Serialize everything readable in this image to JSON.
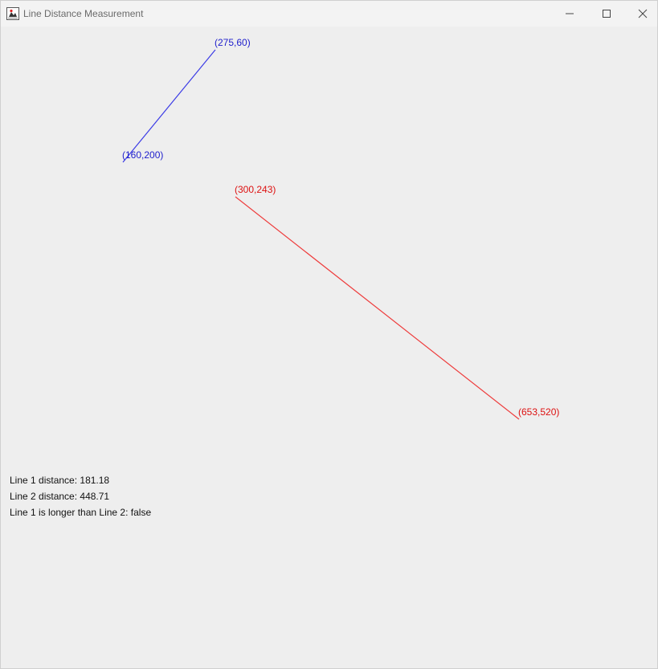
{
  "window": {
    "title": "Line Distance Measurement",
    "app_icon": "java-app-icon",
    "controls": {
      "minimize_icon": "minimize-icon",
      "maximize_icon": "maximize-icon",
      "close_icon": "close-icon"
    }
  },
  "lines": [
    {
      "name": "Line 1",
      "color": "#3b3be6",
      "label_color": "#1e1ecc",
      "start": {
        "label": "(160,200)"
      },
      "end": {
        "label": "(275,60)"
      }
    },
    {
      "name": "Line 2",
      "color": "#ee3b3b",
      "label_color": "#dd1111",
      "start": {
        "label": "(300,243)"
      },
      "end": {
        "label": "(653,520)"
      }
    }
  ],
  "info": {
    "line1_distance": "Line 1 distance: 181.18",
    "line2_distance": "Line 2 distance: 448.71",
    "comparison": "Line 1 is longer than Line 2: false"
  }
}
